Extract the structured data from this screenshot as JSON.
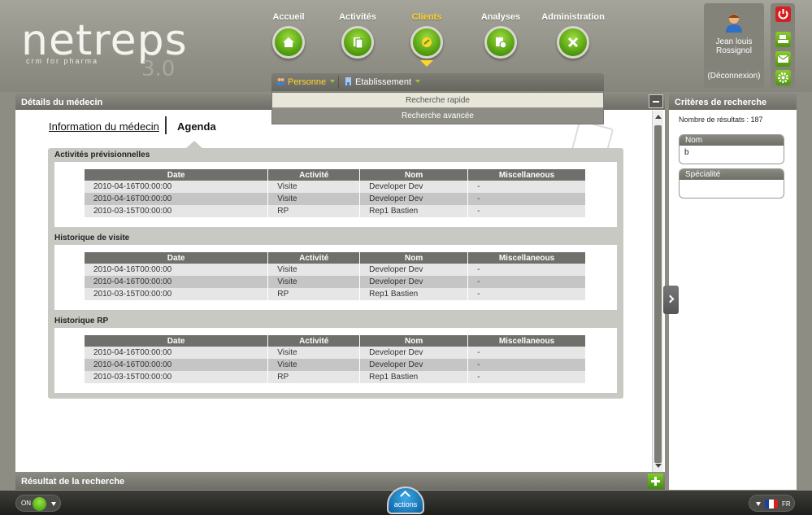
{
  "brand": {
    "logo": "netreps",
    "tagline": "crm for pharma",
    "version": "3.0"
  },
  "nav": [
    {
      "label": "Accueil",
      "icon": "home-icon"
    },
    {
      "label": "Activités",
      "icon": "documents-icon"
    },
    {
      "label": "Clients",
      "icon": "clients-icon",
      "active": true
    },
    {
      "label": "Analyses",
      "icon": "analyses-icon"
    },
    {
      "label": "Administration",
      "icon": "tools-icon"
    }
  ],
  "user": {
    "name_line1": "Jean louis",
    "name_line2": "Rossignol",
    "logout": "(Déconnexion)"
  },
  "subnav": {
    "personne": "Personne",
    "etablissement": "Etablissement"
  },
  "dropdown": {
    "quick": "Recherche rapide",
    "advanced": "Recherche avancée"
  },
  "left_panel": {
    "title": "Détails du médecin"
  },
  "tabs": {
    "info": "Information du médecin",
    "agenda": "Agenda"
  },
  "columns": [
    "Date",
    "Activité",
    "Nom",
    "Miscellaneous"
  ],
  "sections": [
    {
      "title": "Activités prévisionnelles",
      "rows": [
        [
          "2010-04-16T00:00:00",
          "Visite",
          "Developer Dev",
          "-"
        ],
        [
          "2010-04-16T00:00:00",
          "Visite",
          "Developer Dev",
          "-"
        ],
        [
          "2010-03-15T00:00:00",
          "RP",
          "Rep1 Bastien",
          "-"
        ]
      ]
    },
    {
      "title": "Historique de visite",
      "rows": [
        [
          "2010-04-16T00:00:00",
          "Visite",
          "Developer Dev",
          "-"
        ],
        [
          "2010-04-16T00:00:00",
          "Visite",
          "Developer Dev",
          "-"
        ],
        [
          "2010-03-15T00:00:00",
          "RP",
          "Rep1 Bastien",
          "-"
        ]
      ]
    },
    {
      "title": "Historique RP",
      "rows": [
        [
          "2010-04-16T00:00:00",
          "Visite",
          "Developer Dev",
          "-"
        ],
        [
          "2010-04-16T00:00:00",
          "Visite",
          "Developer Dev",
          "-"
        ],
        [
          "2010-03-15T00:00:00",
          "RP",
          "Rep1 Bastien",
          "-"
        ]
      ]
    }
  ],
  "right_panel": {
    "title": "Critères de recherche",
    "results": "Nombre de résultats : 187",
    "criteria": [
      {
        "label": "Nom",
        "value": "b"
      },
      {
        "label": "Spécialité",
        "value": ""
      }
    ]
  },
  "results_bar": {
    "title": "Résultat de la recherche"
  },
  "bottom": {
    "on": "ON",
    "actions": "actions",
    "lang": "FR"
  },
  "colors": {
    "accent_green": "#5fae16",
    "active_yellow": "#ffd52a",
    "header": "#8e8e84",
    "power_red": "#d42020"
  }
}
